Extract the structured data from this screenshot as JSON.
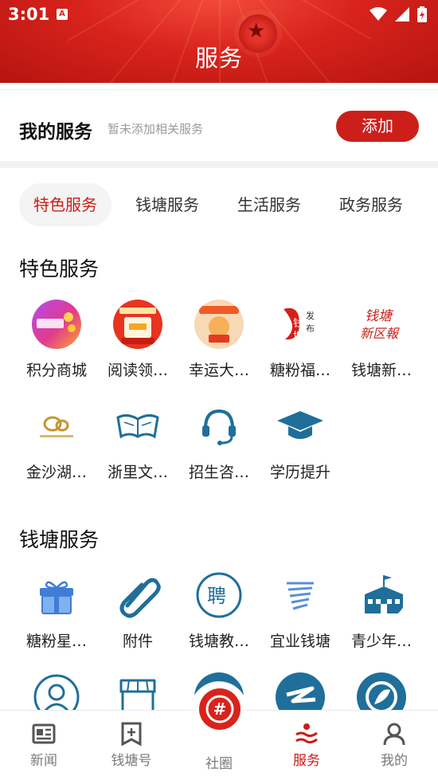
{
  "status_bar": {
    "time": "3:01",
    "notification_badge": "A"
  },
  "header": {
    "title": "服务"
  },
  "my_service": {
    "title": "我的服务",
    "hint": "暂未添加相关服务",
    "add_label": "添加"
  },
  "tabs": [
    {
      "label": "特色服务",
      "active": true
    },
    {
      "label": "钱塘服务",
      "active": false
    },
    {
      "label": "生活服务",
      "active": false
    },
    {
      "label": "政务服务",
      "active": false
    }
  ],
  "section_featured": {
    "title": "特色服务",
    "items": [
      {
        "label": "积分商城",
        "icon": "points-mall-icon"
      },
      {
        "label": "阅读领…",
        "icon": "reading-reward-icon"
      },
      {
        "label": "幸运大…",
        "icon": "lucky-draw-icon"
      },
      {
        "label": "糖粉福…",
        "icon": "fan-benefits-icon"
      },
      {
        "label": "钱塘新…",
        "icon": "qiantang-news-icon"
      },
      {
        "label": "金沙湖…",
        "icon": "jinsha-lake-icon"
      },
      {
        "label": "浙里文…",
        "icon": "open-book-icon"
      },
      {
        "label": "招生咨…",
        "icon": "headset-icon"
      },
      {
        "label": "学历提升",
        "icon": "graduation-cap-icon"
      }
    ]
  },
  "section_qiantang": {
    "title": "钱塘服务",
    "items": [
      {
        "label": "糖粉星…",
        "icon": "gift-icon"
      },
      {
        "label": "附件",
        "icon": "paperclip-icon"
      },
      {
        "label": "钱塘教…",
        "icon": "recruit-icon"
      },
      {
        "label": "宜业钱塘",
        "icon": "wave-logo-icon"
      },
      {
        "label": "青少年…",
        "icon": "school-building-icon"
      }
    ]
  },
  "bottom_nav": [
    {
      "label": "新闻",
      "icon": "newspaper-icon",
      "active": false
    },
    {
      "label": "钱塘号",
      "icon": "bookmark-plus-icon",
      "active": false
    },
    {
      "label": "社圈",
      "icon": "hashtag-icon",
      "active": false
    },
    {
      "label": "服务",
      "icon": "service-icon",
      "active": true
    },
    {
      "label": "我的",
      "icon": "user-icon",
      "active": false
    }
  ],
  "colors": {
    "brand_red": "#cc1f1a",
    "active_text": "#c81d17",
    "icon_blue": "#1f6f9a"
  }
}
